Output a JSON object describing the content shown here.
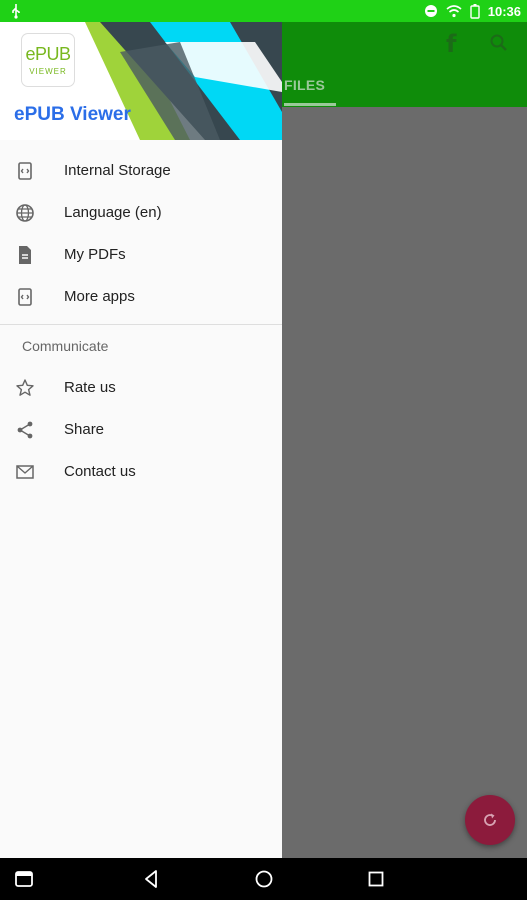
{
  "status_bar": {
    "time": "10:36"
  },
  "app_bar": {
    "tab_label": "FILES"
  },
  "drawer": {
    "logo_top": "ePUB",
    "logo_bottom": "VIEWER",
    "app_title": "ePUB Viewer",
    "items": [
      {
        "label": "Internal Storage",
        "icon": "storage-icon"
      },
      {
        "label": "Language (en)",
        "icon": "globe-icon"
      },
      {
        "label": "My PDFs",
        "icon": "document-icon"
      },
      {
        "label": "More apps",
        "icon": "apps-icon"
      }
    ],
    "section_title": "Communicate",
    "communicate_items": [
      {
        "label": "Rate us",
        "icon": "star-icon"
      },
      {
        "label": "Share",
        "icon": "share-icon"
      },
      {
        "label": "Contact us",
        "icon": "mail-icon"
      }
    ]
  },
  "colors": {
    "status_bar": "#1fd116",
    "app_bar": "#0f8c0a",
    "title_blue": "#2b6ee8",
    "fab": "#8c1b3c",
    "scrim": "#6b6b6b"
  }
}
